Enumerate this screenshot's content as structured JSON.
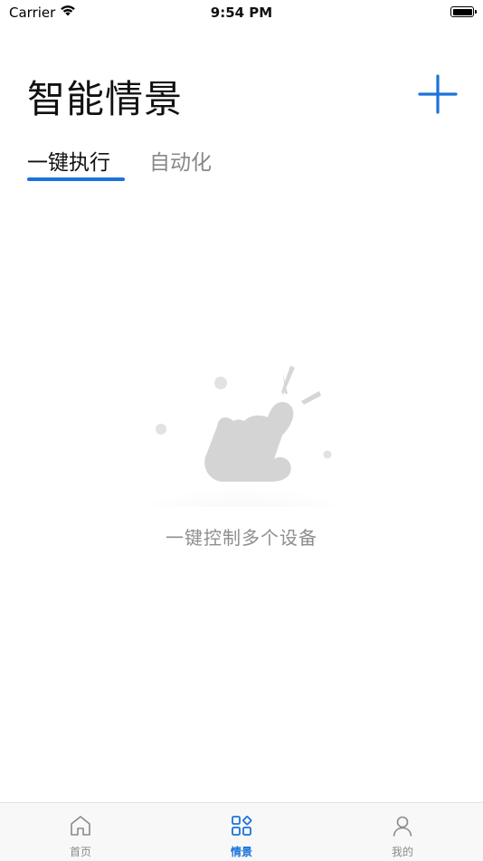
{
  "status_bar": {
    "carrier": "Carrier",
    "time": "9:54 PM"
  },
  "header": {
    "title": "智能情景",
    "add_icon": "plus-icon"
  },
  "tabs": [
    {
      "label": "一键执行",
      "active": true
    },
    {
      "label": "自动化",
      "active": false
    }
  ],
  "empty_state": {
    "icon": "tap-hand-icon",
    "message": "一键控制多个设备"
  },
  "bottom_nav": [
    {
      "label": "首页",
      "icon": "home-icon",
      "active": false
    },
    {
      "label": "情景",
      "icon": "scenes-icon",
      "active": true
    },
    {
      "label": "我的",
      "icon": "user-icon",
      "active": false
    }
  ],
  "colors": {
    "accent": "#1a73d9",
    "muted_text": "#8e8e8e",
    "illustration": "#d4d4d4"
  }
}
